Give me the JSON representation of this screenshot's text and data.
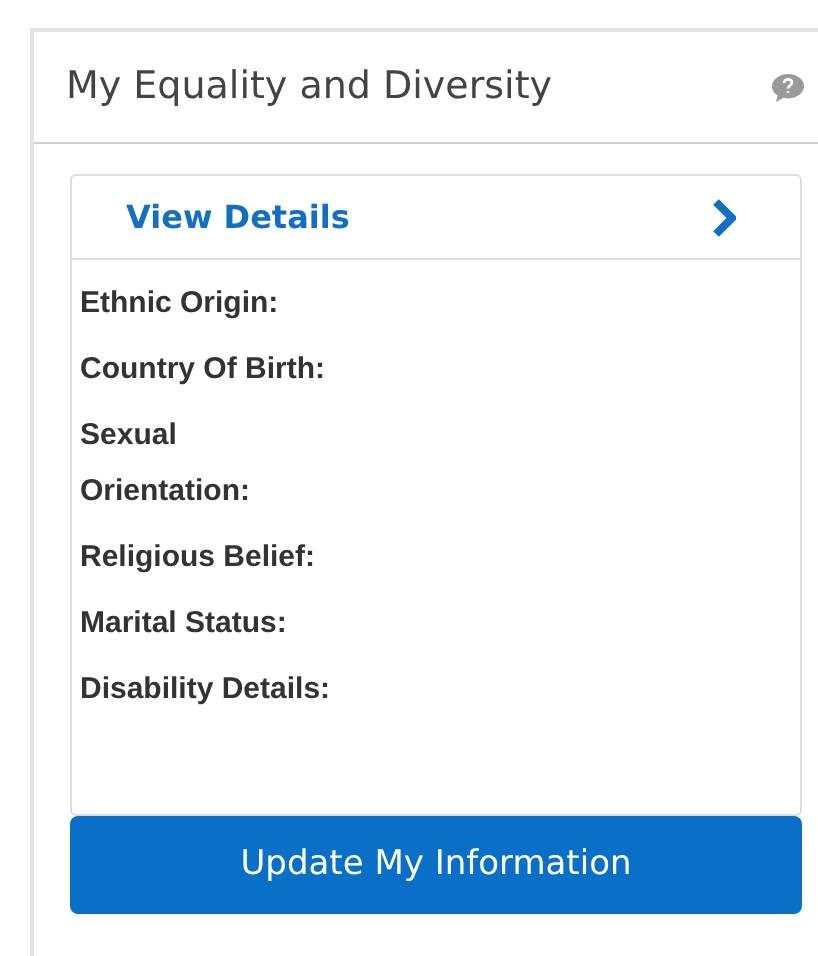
{
  "panel": {
    "title": "My Equality and Diversity"
  },
  "card": {
    "link": "View Details",
    "fields": [
      {
        "label": "Ethnic Origin:"
      },
      {
        "label": "Country Of Birth:"
      },
      {
        "label": "Sexual Orientation:"
      },
      {
        "label": "Religious Belief:"
      },
      {
        "label": "Marital Status:"
      },
      {
        "label": "Disability Details:"
      }
    ]
  },
  "button": "Update My Information"
}
